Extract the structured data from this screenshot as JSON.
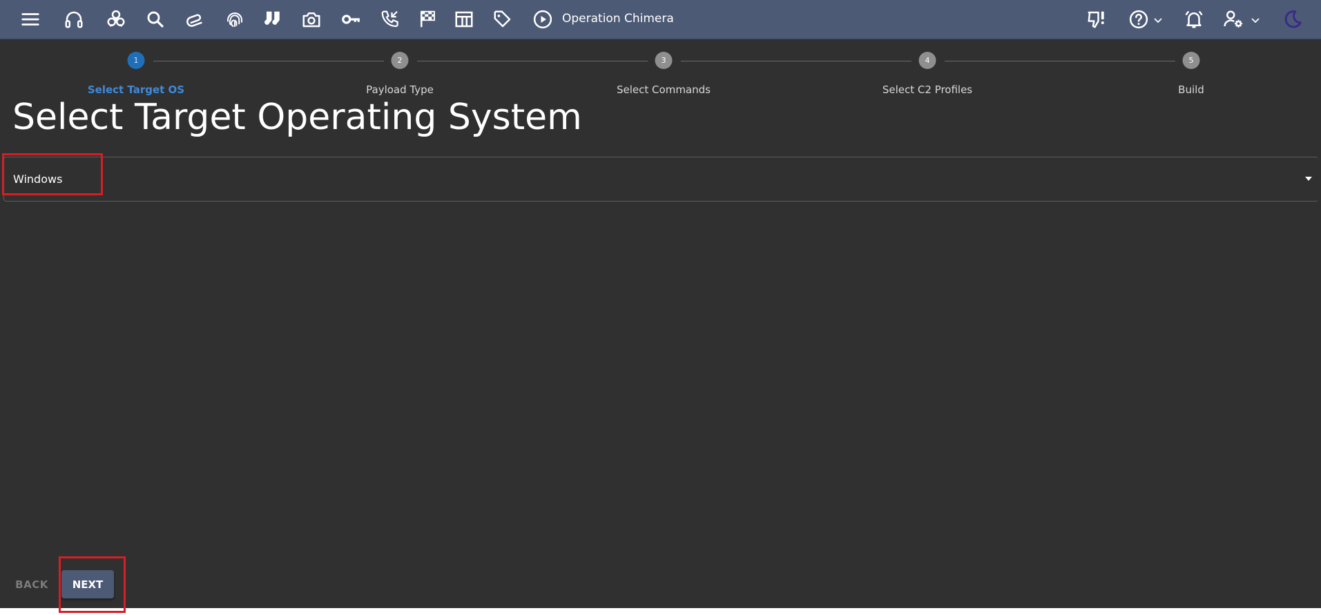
{
  "header": {
    "operation_name": "Operation Chimera",
    "icons": [
      "menu-icon",
      "headphones-icon",
      "biohazard-icon",
      "search-icon",
      "paperclip-icon",
      "fingerprint-icon",
      "socks-icon",
      "camera-icon",
      "key-icon",
      "phone-callback-icon",
      "checkered-flag-icon",
      "table-icon",
      "tag-icon",
      "play-circle-icon",
      "thumb-down-alert-icon",
      "help-icon",
      "alarm-bell-icon",
      "user-settings-icon",
      "moon-icon"
    ]
  },
  "stepper": {
    "steps": [
      {
        "number": "1",
        "label": "Select Target OS",
        "active": true
      },
      {
        "number": "2",
        "label": "Payload Type",
        "active": false
      },
      {
        "number": "3",
        "label": "Select Commands",
        "active": false
      },
      {
        "number": "4",
        "label": "Select C2 Profiles",
        "active": false
      },
      {
        "number": "5",
        "label": "Build",
        "active": false
      }
    ]
  },
  "main": {
    "title": "Select Target Operating System",
    "os_select": {
      "value": "Windows"
    }
  },
  "footer": {
    "back_label": "BACK",
    "next_label": "NEXT"
  },
  "colors": {
    "appbar": "#4d5a75",
    "background": "#303030",
    "active_step": "#1f6fb8",
    "highlight": "#d61e24",
    "moon": "#3a2a8a"
  }
}
